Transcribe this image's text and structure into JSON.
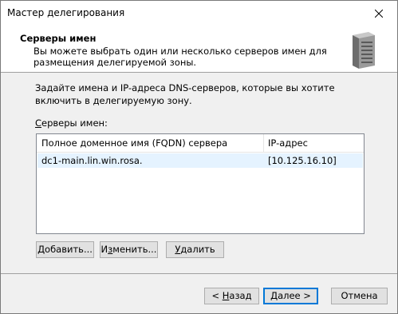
{
  "window": {
    "title": "Мастер делегирования"
  },
  "header": {
    "title": "Серверы имен",
    "subtitle": "Вы можете выбрать один или несколько серверов имен для размещения делегируемой зоны."
  },
  "content": {
    "instruction": "Задайте имена и IP-адреса DNS-серверов, которые вы хотите включить в делегируемую зону.",
    "list_label_pre": "",
    "list_label_accel": "С",
    "list_label_post": "ерверы имен:"
  },
  "listview": {
    "columns": [
      "Полное доменное имя (FQDN) сервера",
      "IP-адрес"
    ],
    "rows": [
      {
        "fqdn": "dc1-main.lin.win.rosa.",
        "ip": "[10.125.16.10]"
      }
    ]
  },
  "buttons": {
    "add": {
      "pre": "",
      "accel": "Д",
      "post": "обавить..."
    },
    "edit": {
      "pre": "И",
      "accel": "з",
      "post": "менить..."
    },
    "remove": {
      "pre": "",
      "accel": "У",
      "post": "далить"
    },
    "back": {
      "pre": "< ",
      "accel": "Н",
      "post": "азад"
    },
    "next": {
      "pre": "",
      "accel": "Д",
      "post": "алее >"
    },
    "cancel": {
      "label": "Отмена"
    }
  },
  "icons": {
    "close": "close-icon",
    "server": "server-icon"
  }
}
